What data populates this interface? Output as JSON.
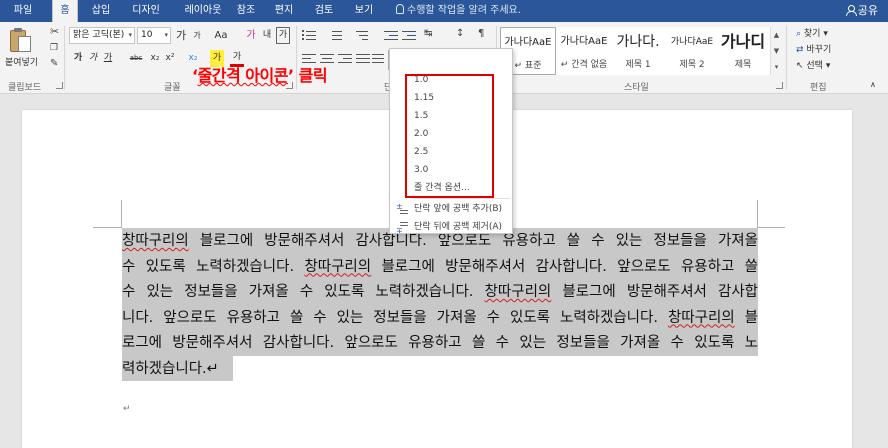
{
  "tabs": [
    "파일",
    "홈",
    "삽입",
    "디자인",
    "레이아웃",
    "참조",
    "편지",
    "검토",
    "보기"
  ],
  "tell_me": "수행할 작업을 알려 주세요.",
  "share": "공유",
  "clipboard": {
    "paste": "붙여넣기",
    "label": "클립보드"
  },
  "font": {
    "name": "맑은 고딕(본)",
    "size": "10",
    "label": "글꼴",
    "bold": "가",
    "italic": "가",
    "underline": "가",
    "strike": "abc",
    "sub": "x₂",
    "sup": "x²",
    "grow": "가",
    "shrink": "가",
    "case": "Aa",
    "clear": "가",
    "highlight": "가",
    "color": "가",
    "phonetic": "내",
    "border_char": "가"
  },
  "paragraph": {
    "label": "단락"
  },
  "styles": {
    "label": "스타일",
    "cards": [
      {
        "sample": "가나다AaE",
        "name": "↵ 표준"
      },
      {
        "sample": "가나다AaE",
        "name": "↵ 간격 없음"
      },
      {
        "sample": "가나다.",
        "name": "제목 1"
      },
      {
        "sample": "가나다AaE",
        "name": "제목 2"
      },
      {
        "sample": "가나디",
        "name": "제목"
      }
    ]
  },
  "editing": {
    "find": "찾기",
    "replace": "바꾸기",
    "select": "선택",
    "label": "편집"
  },
  "annotation": {
    "open": "‘",
    "text": "줄간격 아이콘",
    "close": "’ 클릭"
  },
  "line_spacing_menu": {
    "options": [
      "1.0",
      "1.15",
      "1.5",
      "2.0",
      "2.5",
      "3.0"
    ],
    "more": "줄 간격 옵션...",
    "add_before": "단락 앞에 공백 추가(B)",
    "remove_after": "단락 뒤에 공백 제거(A)"
  },
  "document": {
    "lines": [
      [
        "창따구리의",
        " 블로그에 방문해주셔서 감사합니다. 앞으로도 유용하고 쓸 수 있는 정보들을 가져올"
      ],
      [
        "",
        "수 있도록 노력하겠습니다. ",
        "창따구리의",
        " 블로그에 방문해주셔서 감사합니다. 앞으로도 유용하고 쓸"
      ],
      [
        "",
        "수 있는 정보들을 가져올 수 있도록 노력하겠습니다. ",
        "창따구리의",
        " 블로그에 방문해주셔서 감사합"
      ],
      [
        "",
        "니다. 앞으로도 유용하고 쓸 수 있는 정보들을 가져올 수 있도록 노력하겠습니다. ",
        "창따구리의",
        " 블"
      ],
      [
        "",
        "로그에 방문해주셔서 감사합니다. 앞으로도 유용하고 쓸 수 있는 정보들을 가져올 수 있도록 노"
      ],
      [
        "",
        "력하겠습니다.↵"
      ]
    ],
    "empty_para": "↵"
  }
}
